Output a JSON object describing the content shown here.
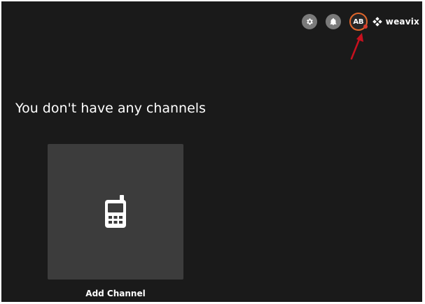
{
  "header": {
    "settings_icon": "gear-icon",
    "notifications_icon": "bell-icon",
    "avatar_initials": "AB",
    "brand_name": "weavix",
    "brand_logo_icon": "weavix-logo-icon"
  },
  "main": {
    "empty_title": "You don't have any channels",
    "add_card": {
      "icon": "radio-device-icon",
      "label": "Add Channel"
    }
  },
  "annotation": {
    "arrow_color": "#c8101e"
  },
  "colors": {
    "background": "#1a1a1a",
    "card": "#3c3c3c",
    "avatar_ring": "#e0662b",
    "avatar_dot": "#d63b2f",
    "icon_button": "#7a7a7a"
  }
}
